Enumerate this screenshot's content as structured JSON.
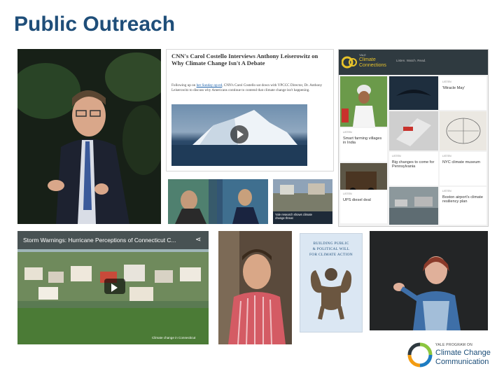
{
  "slide": {
    "title": "Public Outreach"
  },
  "cnn_article": {
    "headline": "CNN's Carol Costello Interviews Anthony Leiserowitz on Why Climate Change Isn't A Debate",
    "body_link": "her Sunday op-ed",
    "body_before": "Following up on ",
    "body_after": ", CNN's Carol Costello sat down with YPCCC Director, Dr. Anthony Leiserowitz to discuss why Americans continue to contend that climate change isn't happening."
  },
  "tv_caption": "Yale research shows climate change threat",
  "climate_connections": {
    "logo_small": "YALE",
    "logo_line1": "Climate",
    "logo_line2": "Connections",
    "nav": "Listen. Watch. Read.",
    "tiles": [
      {
        "tag": "LISTEN",
        "title": "'Miracle May'"
      },
      {
        "tag": "LISTEN",
        "title": "Smart farming villages in India"
      },
      {
        "tag": "LISTEN",
        "title": "Big changes to come for Pennsylvania"
      },
      {
        "tag": "LISTEN",
        "title": "NYC climate museum"
      },
      {
        "tag": "LISTEN",
        "title": "UPS diesel deal"
      },
      {
        "tag": "LISTEN",
        "title": "Boston airport's climate resiliency plan"
      }
    ]
  },
  "video": {
    "title": "Storm Warnings: Hurricane Perceptions of Connecticut C...",
    "watermark": "Climate change in Connecticut"
  },
  "book": {
    "title_lines": [
      "BUILDING PUBLIC",
      "& POLITICAL WILL",
      "FOR CLIMATE ACTION"
    ]
  },
  "logo": {
    "line1": "YALE PROGRAM ON",
    "line2": "Climate Change",
    "line3": "Communication"
  },
  "colors": {
    "title": "#1f4e79",
    "cc_dark": "#2f3a40",
    "logo_green": "#8cc63f",
    "logo_blue": "#1d7cc2",
    "logo_orange": "#f39c12"
  }
}
